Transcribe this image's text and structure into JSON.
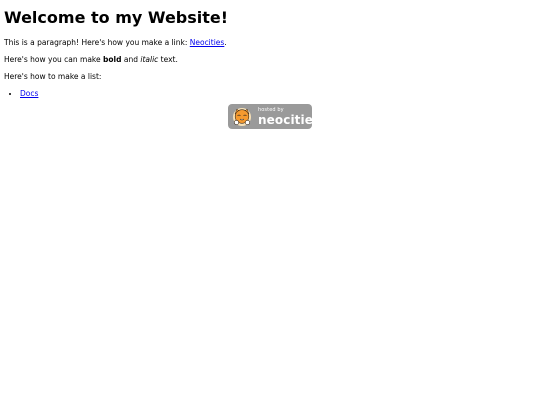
{
  "header": {
    "title": "Welcome to my Website!"
  },
  "content": {
    "p1_prefix": "This is a paragraph! Here's how you make a link: ",
    "p1_link": "Neocities",
    "p1_suffix": ".",
    "p2_prefix": "Here's how you can make ",
    "p2_bold": "bold",
    "p2_middle": " and ",
    "p2_italic": "italic",
    "p2_suffix": " text.",
    "p3": "Here's how to make a list:",
    "list": [
      {
        "label": "Docs"
      }
    ]
  },
  "badge": {
    "small_text": "hosted by",
    "big_text": "neocities",
    "colors": {
      "background": "#9a9a9a",
      "text": "#ffffff"
    }
  },
  "colors": {
    "link": "#0000ee",
    "text": "#000000",
    "background": "#ffffff"
  }
}
